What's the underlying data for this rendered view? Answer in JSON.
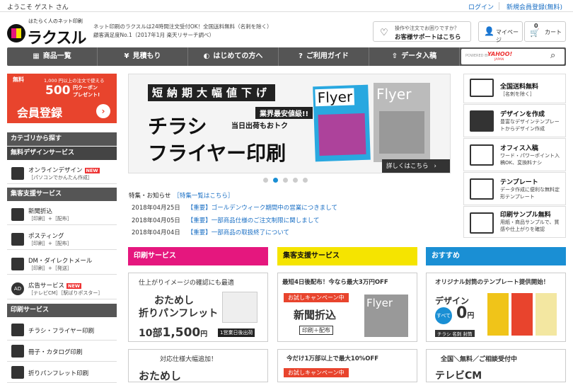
{
  "topbar": {
    "welcome": "ようこそ ゲスト さん",
    "login": "ログイン",
    "register": "新規会員登録(無料)"
  },
  "header": {
    "logo_small": "はたらく人のネット印刷",
    "logo_main": "ラクスル",
    "desc1": "ネット印刷のラクスルは24時間注文受付OK！全国送料無料（名刺を除く）",
    "desc2": "顧客満足度No.1（2017年1月 楽天リサーチ調べ）",
    "support_line1": "操作や注文でお困りですか？",
    "support_line2": "お客様サポートはこちら",
    "mypage": "マイページ",
    "cart": "カート",
    "cart_count": "0"
  },
  "nav": {
    "items": [
      {
        "label": "商品一覧",
        "icon": "grid-icon"
      },
      {
        "label": "見積もり",
        "icon": "yen-icon"
      },
      {
        "label": "はじめての方へ",
        "icon": "beginner-icon"
      },
      {
        "label": "ご利用ガイド",
        "icon": "question-icon"
      },
      {
        "label": "データ入稿",
        "icon": "upload-icon"
      }
    ],
    "search_powered": "POWERED BY",
    "search_brand": "YAHOO!",
    "search_brand_sub": "JAPAN"
  },
  "promo": {
    "tag": "無料",
    "line1": "1,000 円以上の注文で使える",
    "line2": "500",
    "line2b": "円クーポン",
    "line2c": "プレゼント!",
    "line3": "会員登録"
  },
  "sidebar": {
    "h1": "カテゴリから探す",
    "h2": "無料デザインサービス",
    "h3": "集客支援サービス",
    "h4": "印刷サービス",
    "design": {
      "label": "オンラインデザイン",
      "sub": "［パソコンでかんたん作成］",
      "badge": "NEW"
    },
    "sales": [
      {
        "label": "新聞折込",
        "sub": "［印刷］+［配布］"
      },
      {
        "label": "ポスティング",
        "sub": "［印刷］+［配布］"
      },
      {
        "label": "DM・ダイレクトメール",
        "sub": "［印刷］+［発送］"
      },
      {
        "label": "広告サービス",
        "sub": "［テレビCM］［駅ばりポスター］",
        "badge": "NEW"
      }
    ],
    "print": [
      {
        "label": "チラシ・フライヤー印刷"
      },
      {
        "label": "冊子・カタログ印刷"
      },
      {
        "label": "折りパンフレット印刷"
      }
    ]
  },
  "banner": {
    "title": "短納期大幅値下げ",
    "h1": "チラシ",
    "h2": "フライヤー印刷",
    "s1": "業界最安値級!!",
    "s2": "当日出荷もおトク",
    "flyer": "Flyer",
    "more": "詳しくはこちら"
  },
  "news": {
    "header": "特集・お知らせ",
    "link": "［特集一覧はこちら］",
    "items": [
      {
        "date": "2018年04月25日",
        "text": "【重要】ゴールデンウィーク期間中の営業につきまして"
      },
      {
        "date": "2018年04月05日",
        "text": "【重要】一部商品仕様のご注文制限に関しまして"
      },
      {
        "date": "2018年04月04日",
        "text": "【重要】一部商品の取扱終了について"
      }
    ]
  },
  "right": [
    {
      "title": "全国送料無料",
      "desc": "［名刺を除く］"
    },
    {
      "title": "デザインを作成",
      "desc": "豊富なデザインテンプレートからデザイン作成"
    },
    {
      "title": "オフィス入稿",
      "desc": "ワード・パワーポイント入稿OK、変換料ナシ"
    },
    {
      "title": "テンプレート",
      "desc": "データ作成に便利な無料定形テンプレート"
    },
    {
      "title": "印刷サンプル無料",
      "desc": "用紙・商品サンプルで、質感や仕上がりを確認"
    }
  ],
  "cols": [
    {
      "h": "印刷サービス",
      "color": "#e5177e",
      "c1": {
        "top": "仕上がりイメージの確認にも最適",
        "a": "おためし",
        "b": "折りパンフレット",
        "price": "1,500",
        "qty": "10部",
        "unit": "円",
        "ship": "1営業日後出荷"
      },
      "c2": {
        "top": "対応仕様大幅追加！",
        "a": "おためし"
      }
    },
    {
      "h": "集客支援サービス",
      "color": "#f5e400",
      "c1": {
        "top": "最短4日後配布！今なら最大3万円OFF",
        "camp": "お試しキャンペーン中",
        "a": "新聞折込",
        "tags": "印刷＋配布",
        "flyer": "Flyer"
      },
      "c2": {
        "top": "今だけ1万部以上で最大10%OFF",
        "camp": "お試しキャンペーン中"
      }
    },
    {
      "h": "おすすめ",
      "color": "#1a8fd4",
      "c1": {
        "top": "オリジナル封筒のテンプレート提供開始！",
        "a": "デザイン",
        "b": "すべて",
        "price": "0",
        "unit": "円",
        "chips": "チラシ 名刺 封筒"
      },
      "c2": {
        "top": "全国＼無料／ご相談受付中",
        "a": "テレビCM"
      }
    }
  ]
}
